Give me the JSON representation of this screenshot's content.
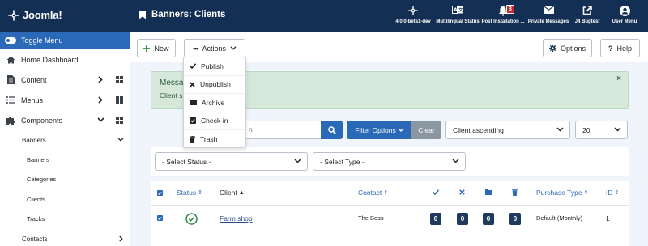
{
  "header": {
    "logo_text": "Joomla!",
    "page_title": "Banners: Clients",
    "items": [
      {
        "label": "4.0.0-beta1-dev",
        "icon": "joomla-icon"
      },
      {
        "label": "Multilingual Status",
        "icon": "language-icon"
      },
      {
        "label": "Post Installation ...",
        "icon": "bell-icon",
        "badge": "3"
      },
      {
        "label": "Private Messages",
        "icon": "envelope-icon"
      },
      {
        "label": "J4 Bugtest",
        "icon": "external-link-icon"
      },
      {
        "label": "User Menu",
        "icon": "user-icon"
      }
    ]
  },
  "sidebar": {
    "toggle_label": "Toggle Menu",
    "items": [
      {
        "label": "Home Dashboard"
      },
      {
        "label": "Content"
      },
      {
        "label": "Menus"
      },
      {
        "label": "Components"
      }
    ],
    "sub_banners": "Banners",
    "subsub": [
      "Banners",
      "Categories",
      "Clients",
      "Tracks"
    ],
    "sub_contacts": "Contacts"
  },
  "toolbar": {
    "new_label": "New",
    "actions_label": "Actions",
    "options_label": "Options",
    "help_label": "Help",
    "actions_menu": [
      "Publish",
      "Unpublish",
      "Archive",
      "Check-in",
      "Trash"
    ]
  },
  "alert": {
    "title": "Messa",
    "message": "Client s"
  },
  "search": {
    "value": "n",
    "filter_options_label": "Filter Options",
    "clear_label": "Clear",
    "sort_value": "Client ascending",
    "limit_value": "20"
  },
  "filters": {
    "status_value": "- Select Status -",
    "type_value": "- Select Type -"
  },
  "table": {
    "headers": {
      "status": "Status",
      "client": "Client",
      "contact": "Contact",
      "purchase_type": "Purchase Type",
      "id": "ID"
    },
    "rows": [
      {
        "client": "Farm shop",
        "contact": "The Boss",
        "published": "0",
        "unpublished": "0",
        "archived": "0",
        "trashed": "0",
        "purchase_type": "Default (Monthly)",
        "id": "1"
      }
    ]
  },
  "colors": {
    "header_bg": "#132f53",
    "primary": "#2a69b8",
    "alert_bg": "#d5e8da",
    "success": "#2f8a46"
  }
}
